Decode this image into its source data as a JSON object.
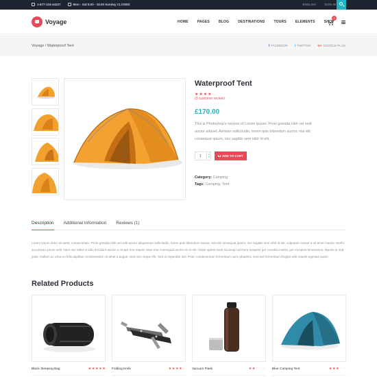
{
  "topbar": {
    "phone": "1-677-124-44227",
    "hours": "Mon - Sat 8.00 - 18.00 Sunday CLOSED",
    "language": "ENGLISH",
    "signin": "SIGN IN"
  },
  "header": {
    "logo": "Voyage",
    "nav": [
      "HOME",
      "PAGES",
      "BLOG",
      "DESTINATIONS",
      "TOURS",
      "ELEMENTS",
      "SHOP"
    ],
    "cart_count": "0"
  },
  "breadcrumb": "Voyage / Waterproof Tent",
  "share": {
    "facebook": "FACEBOOK",
    "twitter": "TWITTER",
    "google": "GOOGLE PLUS"
  },
  "product": {
    "title": "Waterproof Tent",
    "rating": 4,
    "review_link": "(3 customer review)",
    "price": "£170.00",
    "description": "This is Photoshop's version of Lorem Ipsum. Proin gravida nibh vel velit auctor aliquet. Aenean sollicitudin, lorem quis bibendum auctor, nisi elit consequat ipsum, nec sagittis sem nibh id elit.",
    "quantity": "1",
    "add_to_cart": "ADD TO CART",
    "category_label": "Category:",
    "category": "Camping",
    "tags_label": "Tags:",
    "tags": "Camping, Tent"
  },
  "tabs": [
    "Description",
    "Additional Information",
    "Reviews (1)"
  ],
  "tab_description": "Lorem ipsum dolor sit amet, consectetuer. Proin gravida nibh vel velit auctor aliquenean sollicitudin, lorem quis bibendum auctor, nisi elit consequat ipsum, nec sagittis sem nibh id elit, vulputate cursus a sit amet mauris. Morbi accumsan ipsum velit. Nam nec tellus a odio tincidunt auctor a ornare non mauris vitae erat consequat auctor eu in elit. Class aptent taciti sociosqu ad litora torquent per conubia nostra, per inceptos himenaeos. Mauris in erat justo. Nullam ac urna eu felis dapibus condimentum sit amet a augue. Sed non neque elit. Sed ut imperdiet nisi. Proin condimentum fermentum nunc pharetra, erat sed fermentum feugiat velit mauris egestas quam.",
  "related": {
    "title": "Related Products",
    "items": [
      {
        "name": "Black Sleeping Bag",
        "rating": 5
      },
      {
        "name": "Folding Knife",
        "rating": 4
      },
      {
        "name": "Vacuum Flask",
        "rating": 2
      },
      {
        "name": "Blue Camping Tent",
        "rating": 3
      }
    ]
  },
  "colors": {
    "accent": "#e74a55",
    "teal": "#22b3c1",
    "dark": "#1f2530"
  }
}
